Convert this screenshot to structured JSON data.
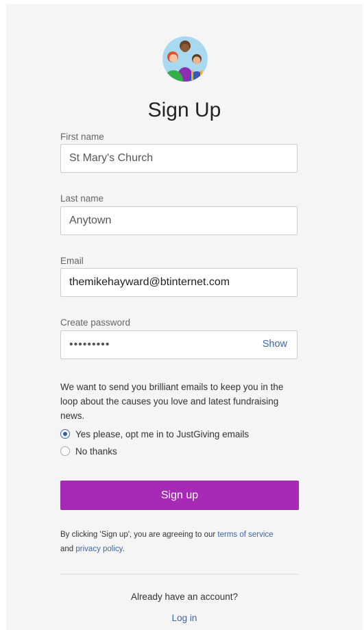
{
  "header": {
    "title": "Sign Up"
  },
  "form": {
    "first_name": {
      "label": "First name",
      "value": "St Mary's Church"
    },
    "last_name": {
      "label": "Last name",
      "value": "Anytown"
    },
    "email": {
      "label": "Email",
      "value": "themikehayward@btinternet.com"
    },
    "password": {
      "label": "Create password",
      "value": "*********",
      "show_label": "Show"
    }
  },
  "marketing": {
    "text": "We want to send you brilliant emails to keep you in the loop about the causes you love and latest fundraising news.",
    "options": [
      {
        "label": "Yes please, opt me in to JustGiving emails",
        "checked": true
      },
      {
        "label": "No thanks",
        "checked": false
      }
    ]
  },
  "submit": {
    "label": "Sign up"
  },
  "legal": {
    "prefix": "By clicking 'Sign up', you are agreeing to our",
    "terms_link": "terms of service",
    "and_text": "and",
    "privacy_link": "privacy policy",
    "suffix": "."
  },
  "footer": {
    "question": "Already have an account?",
    "login_link": "Log in"
  },
  "colors": {
    "accent": "#a62ab5",
    "link": "#3b66a8",
    "background": "#f5f5f5"
  }
}
